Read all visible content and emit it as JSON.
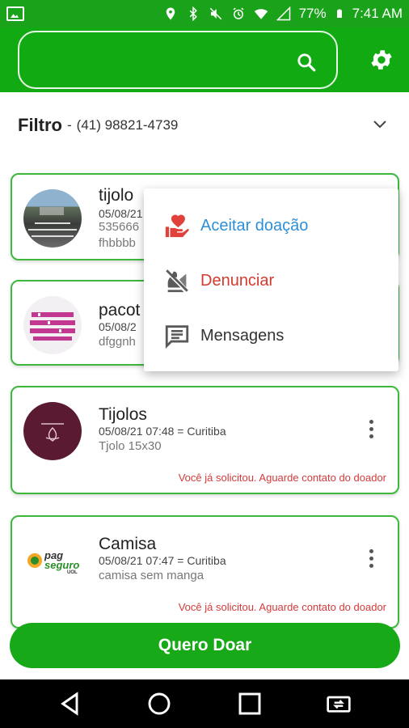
{
  "status_bar": {
    "battery": "77%",
    "time": "7:41 AM"
  },
  "app_bar": {
    "search": {
      "value": "",
      "placeholder": ""
    },
    "icons": {
      "search": "search-icon",
      "settings": "gear-icon"
    }
  },
  "filter": {
    "label": "Filtro",
    "separator": "-",
    "phone": "(41) 98821-4739"
  },
  "cards": [
    {
      "title": "tijolo",
      "meta": "05/08/21",
      "line2": "535666",
      "desc": "fhbbbb"
    },
    {
      "title": "pacot",
      "meta": "05/08/2",
      "desc": "dfggnh"
    },
    {
      "title": "Tijolos",
      "meta": "05/08/21 07:48 = Curitiba",
      "desc": "Tjolo 15x30",
      "notice": "Você já solicitou. Aguarde contato do doador"
    },
    {
      "title": "Camisa",
      "meta": "05/08/21 07:47 = Curitiba",
      "desc": "camisa sem manga",
      "notice": "Você já solicitou. Aguarde contato do doador",
      "logo": {
        "line1": "pag",
        "line2": "seguro",
        "line3": "UOL"
      }
    }
  ],
  "popup_menu": {
    "items": [
      {
        "label": "Aceitar doação",
        "icon": "hand-heart-icon",
        "color": "#2f8fd6"
      },
      {
        "label": "Denunciar",
        "icon": "report-off-icon",
        "color": "#d43a2f"
      },
      {
        "label": "Mensagens",
        "icon": "message-icon",
        "color": "#333333"
      }
    ]
  },
  "cta": {
    "label": "Quero Doar"
  },
  "colors": {
    "primary": "#17a917",
    "card_border": "#3cb83c",
    "notice": "#d33b3b"
  }
}
